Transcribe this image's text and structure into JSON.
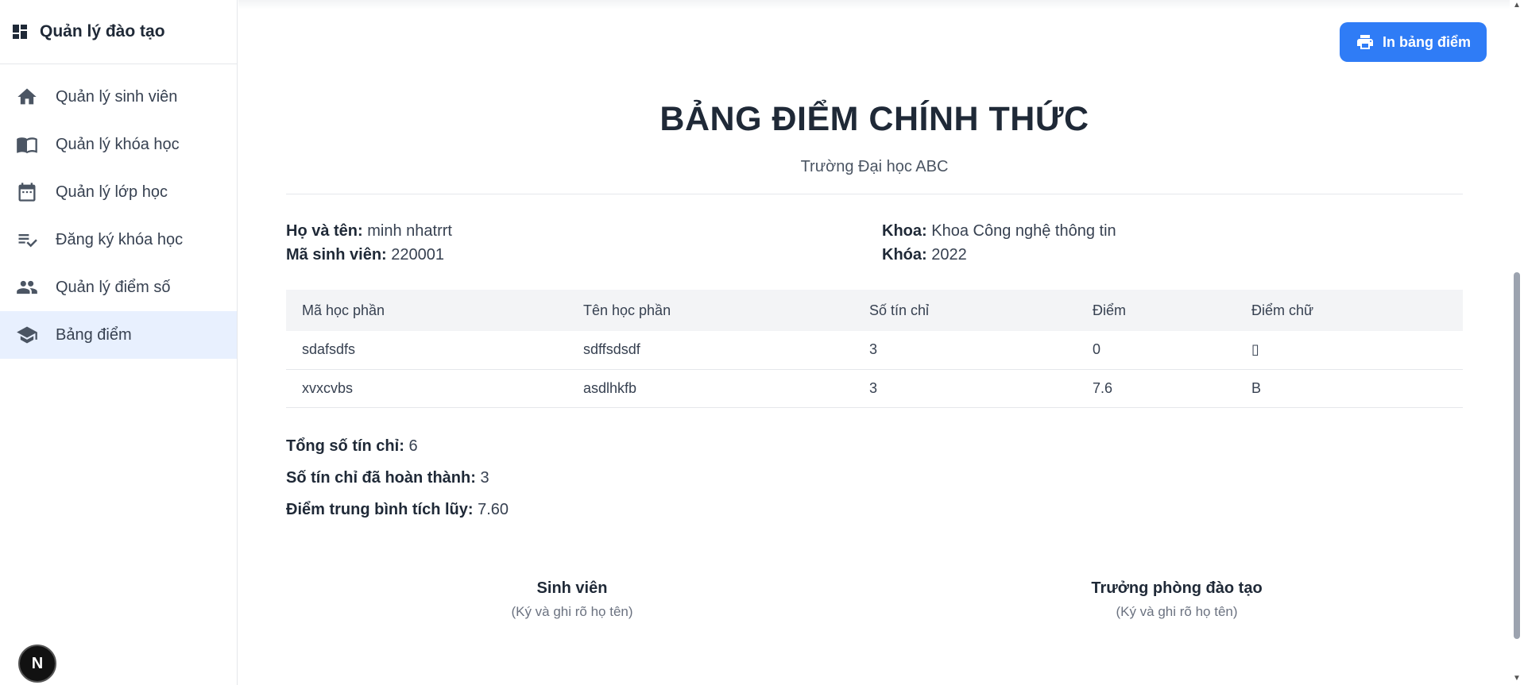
{
  "sidebar": {
    "brand": "Quản lý đào tạo",
    "items": [
      {
        "label": "Quản lý sinh viên",
        "icon": "home-icon"
      },
      {
        "label": "Quản lý khóa học",
        "icon": "book-icon"
      },
      {
        "label": "Quản lý lớp học",
        "icon": "calendar-icon"
      },
      {
        "label": "Đăng ký khóa học",
        "icon": "checklist-icon"
      },
      {
        "label": "Quản lý điểm số",
        "icon": "people-icon"
      },
      {
        "label": "Bảng điểm",
        "icon": "school-icon",
        "active": true
      }
    ]
  },
  "badge": "N",
  "toolbar": {
    "print_label": "In bảng điểm"
  },
  "transcript": {
    "title": "BẢNG ĐIỂM CHÍNH THỨC",
    "school": "Trường Đại học ABC",
    "student": {
      "name_label": "Họ và tên:",
      "name": "minh nhatrrt",
      "id_label": "Mã sinh viên:",
      "id": "220001",
      "faculty_label": "Khoa:",
      "faculty": "Khoa Công nghệ thông tin",
      "cohort_label": "Khóa:",
      "cohort": "2022"
    },
    "table": {
      "headers": [
        "Mã học phần",
        "Tên học phần",
        "Số tín chỉ",
        "Điểm",
        "Điểm chữ"
      ],
      "rows": [
        [
          "sdafsdfs",
          "sdffsdsdf",
          "3",
          "0",
          "▯"
        ],
        [
          "xvxcvbs",
          "asdlhkfb",
          "3",
          "7.6",
          "B"
        ]
      ]
    },
    "summary": {
      "total_label": "Tổng số tín chỉ:",
      "total": "6",
      "done_label": "Số tín chỉ đã hoàn thành:",
      "done": "3",
      "gpa_label": "Điểm trung bình tích lũy:",
      "gpa": "7.60"
    },
    "signatures": {
      "student_title": "Sinh viên",
      "student_note": "(Ký và ghi rõ họ tên)",
      "head_title": "Trưởng phòng đào tạo",
      "head_note": "(Ký và ghi rõ họ tên)"
    }
  },
  "colors": {
    "accent": "#2f7cf6",
    "active_bg": "#e8f0fe"
  }
}
